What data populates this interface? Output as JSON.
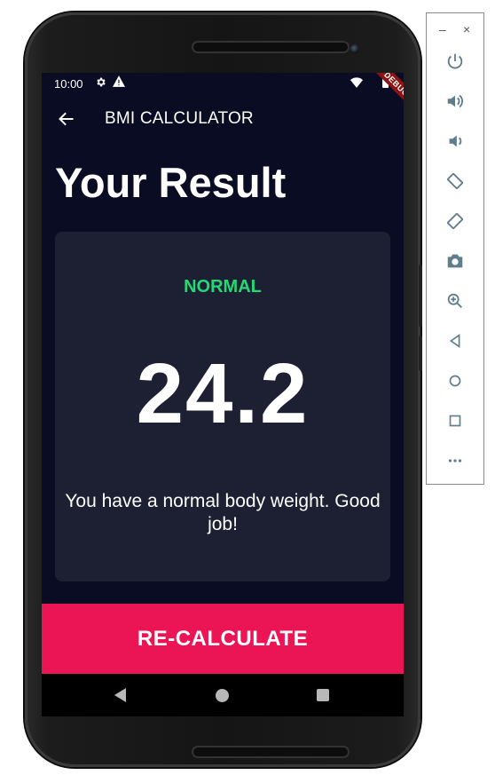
{
  "status_bar": {
    "time": "10:00",
    "debug_label": "DEBUG"
  },
  "app_bar": {
    "title": "BMI CALCULATOR",
    "back_icon": "arrow-back-icon"
  },
  "page": {
    "heading": "Your Result"
  },
  "result_card": {
    "status": "NORMAL",
    "bmi_value": "24.2",
    "message": "You have a normal body weight. Good job!"
  },
  "action": {
    "recalculate_label": "RE-CALCULATE"
  },
  "colors": {
    "background": "#090c22",
    "card": "#1d1f33",
    "status_normal": "#24d876",
    "accent_button": "#eb1555"
  },
  "emulator_toolbar": {
    "window_controls": [
      "–",
      "×"
    ],
    "buttons": [
      "power-icon",
      "volume-up-icon",
      "volume-down-icon",
      "rotate-left-icon",
      "rotate-right-icon",
      "camera-icon",
      "zoom-icon",
      "back-icon",
      "home-icon",
      "overview-icon",
      "more-icon"
    ]
  }
}
